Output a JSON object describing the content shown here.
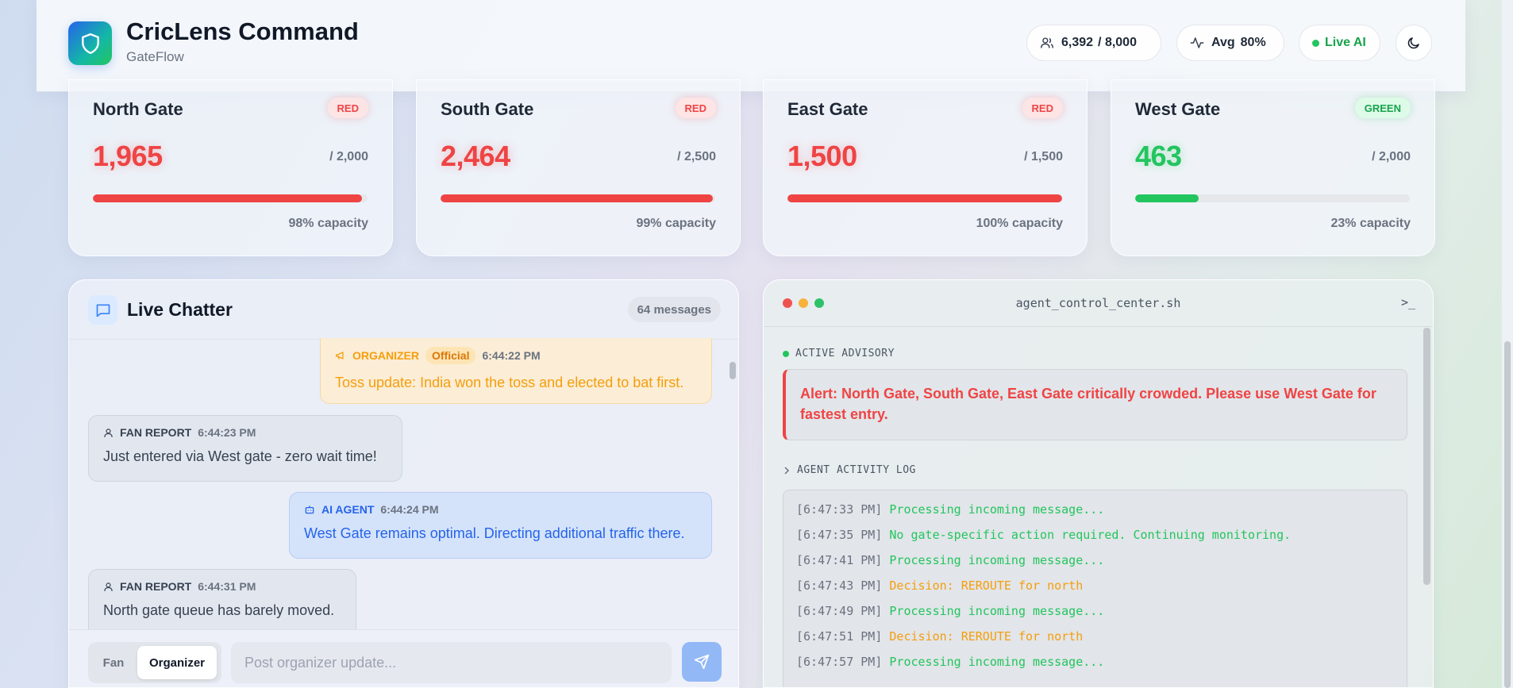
{
  "header": {
    "title": "CricLens Command",
    "subtitle": "GateFlow",
    "total_count": "6,392",
    "total_capacity": "/ 8,000",
    "avg_label": "Avg",
    "avg_value": "80%",
    "live_label": "Live AI"
  },
  "gates": [
    {
      "name": "North Gate",
      "status": "RED",
      "count": "1,965",
      "capacity": "/ 2,000",
      "fill_percent": 98,
      "capacity_label": "98% capacity"
    },
    {
      "name": "South Gate",
      "status": "RED",
      "count": "2,464",
      "capacity": "/ 2,500",
      "fill_percent": 99,
      "capacity_label": "99% capacity"
    },
    {
      "name": "East Gate",
      "status": "RED",
      "count": "1,500",
      "capacity": "/ 1,500",
      "fill_percent": 100,
      "capacity_label": "100% capacity"
    },
    {
      "name": "West Gate",
      "status": "GREEN",
      "count": "463",
      "capacity": "/ 2,000",
      "fill_percent": 23,
      "capacity_label": "23% capacity"
    }
  ],
  "chatter": {
    "title": "Live Chatter",
    "message_count": "64 messages",
    "messages": [
      {
        "type": "ORGANIZER",
        "badge": "Official",
        "time": "6:44:22 PM",
        "text": "Toss update: India won the toss and elected to bat first."
      },
      {
        "type": "FAN REPORT",
        "time": "6:44:23 PM",
        "text": "Just entered via West gate - zero wait time!"
      },
      {
        "type": "AI AGENT",
        "time": "6:44:24 PM",
        "text": "West Gate remains optimal. Directing additional traffic there."
      },
      {
        "type": "FAN REPORT",
        "time": "6:44:31 PM",
        "text": "North gate queue has barely moved."
      }
    ],
    "roles": {
      "fan": "Fan",
      "organizer": "Organizer"
    },
    "input_placeholder": "Post organizer update..."
  },
  "terminal": {
    "filename": "agent_control_center.sh",
    "prompt_glyph": ">_",
    "advisory_label": "ACTIVE ADVISORY",
    "advisory_text": "Alert: North Gate, South Gate, East Gate critically crowded. Please use West Gate for fastest entry.",
    "log_label": "AGENT ACTIVITY LOG",
    "log": [
      {
        "time": "[6:47:33 PM]",
        "text": "Processing incoming message...",
        "color": "green"
      },
      {
        "time": "[6:47:35 PM]",
        "text": "No gate-specific action required. Continuing monitoring.",
        "color": "green"
      },
      {
        "time": "[6:47:41 PM]",
        "text": "Processing incoming message...",
        "color": "green"
      },
      {
        "time": "[6:47:43 PM]",
        "text": "Decision: REROUTE for north",
        "color": "orange"
      },
      {
        "time": "[6:47:49 PM]",
        "text": "Processing incoming message...",
        "color": "green"
      },
      {
        "time": "[6:47:51 PM]",
        "text": "Decision: REROUTE for north",
        "color": "orange"
      },
      {
        "time": "[6:47:57 PM]",
        "text": "Processing incoming message...",
        "color": "green"
      }
    ]
  },
  "colors": {
    "red": "#ef4444",
    "green": "#22c55e",
    "orange": "#f59e0b",
    "blue": "#2563eb"
  },
  "icons": {
    "logo": "shield-icon",
    "count": "users-icon",
    "avg": "activity-icon",
    "theme": "moon-icon",
    "chat": "message-square-icon",
    "send": "send-icon"
  }
}
